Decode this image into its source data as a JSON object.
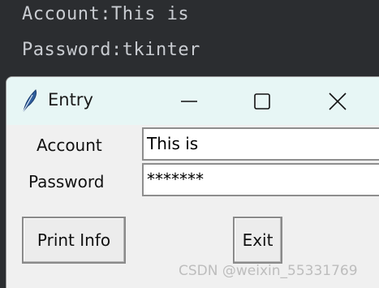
{
  "console": {
    "line1": "Account:This is",
    "line2": "Password:tkinter"
  },
  "window": {
    "title": "Entry",
    "icon": "feather-icon",
    "controls": [
      "minimize-icon",
      "maximize-icon",
      "close-icon"
    ]
  },
  "form": {
    "account_label": "Account",
    "account_value": "This is",
    "password_label": "Password",
    "password_masked": "*******"
  },
  "buttons": {
    "print_label": "Print Info",
    "exit_label": "Exit"
  },
  "watermark": "CSDN @weixin_55331769"
}
